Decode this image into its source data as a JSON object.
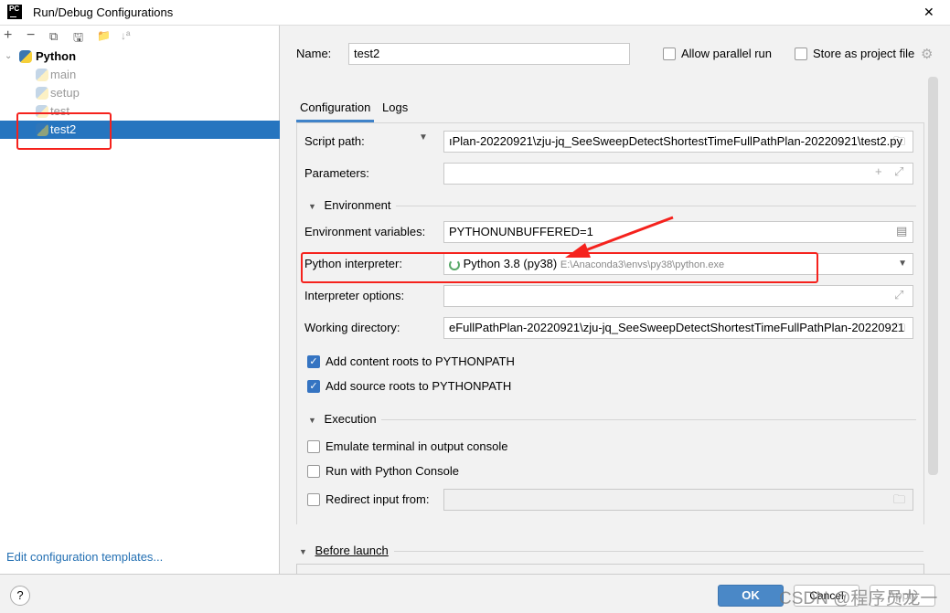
{
  "window": {
    "title": "Run/Debug Configurations",
    "close": "✕",
    "logo": "PC"
  },
  "toolbar": {
    "add": "+",
    "remove": "−",
    "copy": "⧉",
    "save": "🖫",
    "folder": "📁",
    "sort": "↓ª"
  },
  "tree": {
    "root": "Python",
    "items": [
      {
        "label": "main"
      },
      {
        "label": "setup"
      },
      {
        "label": "test"
      },
      {
        "label": "test2",
        "selected": true
      }
    ]
  },
  "edit_templates": "Edit configuration templates...",
  "name": {
    "label": "Name:",
    "value": "test2"
  },
  "allow_parallel": {
    "label": "Allow parallel run",
    "checked": false
  },
  "store_project": {
    "label": "Store as project file",
    "checked": false
  },
  "tabs": [
    {
      "label": "Configuration",
      "active": true
    },
    {
      "label": "Logs"
    }
  ],
  "script_path": {
    "label": "Script path:",
    "value": "ıPlan-20220921\\zju-jq_SeeSweepDetectShortestTimeFullPathPlan-20220921\\test2.py"
  },
  "parameters": {
    "label": "Parameters:",
    "value": ""
  },
  "environment": {
    "title": "Environment",
    "env_vars_label": "Environment variables:",
    "env_vars": "PYTHONUNBUFFERED=1",
    "interpreter_label": "Python interpreter:",
    "interpreter": "Python 3.8 (py38)",
    "interpreter_path": "E:\\Anaconda3\\envs\\py38\\python.exe",
    "interp_options_label": "Interpreter options:",
    "working_dir_label": "Working directory:",
    "working_dir": "eFullPathPlan-20220921\\zju-jq_SeeSweepDetectShortestTimeFullPathPlan-20220921",
    "content_roots": "Add content roots to PYTHONPATH",
    "source_roots": "Add source roots to PYTHONPATH"
  },
  "execution": {
    "title": "Execution",
    "emulate": "Emulate terminal in output console",
    "console": "Run with Python Console",
    "redirect": "Redirect input from:"
  },
  "before_launch": "Before launch",
  "buttons": {
    "help": "?",
    "ok": "OK",
    "cancel": "Cancel",
    "apply": "Apply"
  },
  "watermark": "CSDN @程序员龙一",
  "colors": {
    "selection": "#2675bf",
    "ok": "#4a88c7",
    "annotation": "#f5221d"
  }
}
